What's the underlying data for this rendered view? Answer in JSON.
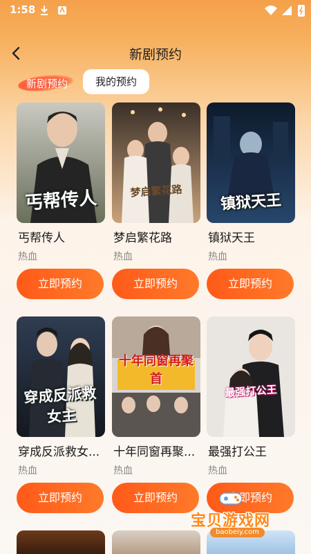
{
  "status_bar": {
    "time": "1:58"
  },
  "header": {
    "title": "新剧预约"
  },
  "tabs": [
    {
      "label": "新剧预约",
      "active": true
    },
    {
      "label": "我的预约",
      "active": false
    }
  ],
  "cards": [
    {
      "title": "丐帮传人",
      "tag": "热血",
      "button": "立即预约",
      "poster_text": "丐帮传人"
    },
    {
      "title": "梦启繁花路",
      "tag": "热血",
      "button": "立即预约",
      "poster_text": "梦启繁花路"
    },
    {
      "title": "镇狱天王",
      "tag": "热血",
      "button": "立即预约",
      "poster_text": "镇狱天王"
    },
    {
      "title": "穿成反派救女...",
      "tag": "热血",
      "button": "立即预约",
      "poster_text": "穿成反派救女主"
    },
    {
      "title": "十年同窗再聚...",
      "tag": "热血",
      "button": "立即预约",
      "poster_text": "十年同窗再聚首"
    },
    {
      "title": "最强打公王",
      "tag": "热血",
      "button": "立即预约",
      "poster_text": "最强打公王"
    }
  ],
  "watermark": {
    "text": "宝贝游戏网",
    "url": "baobeiy.com"
  },
  "colors": {
    "accent": "#ff6a1f",
    "header_gradient": "#f5a04a",
    "tag_gray": "#888888"
  }
}
